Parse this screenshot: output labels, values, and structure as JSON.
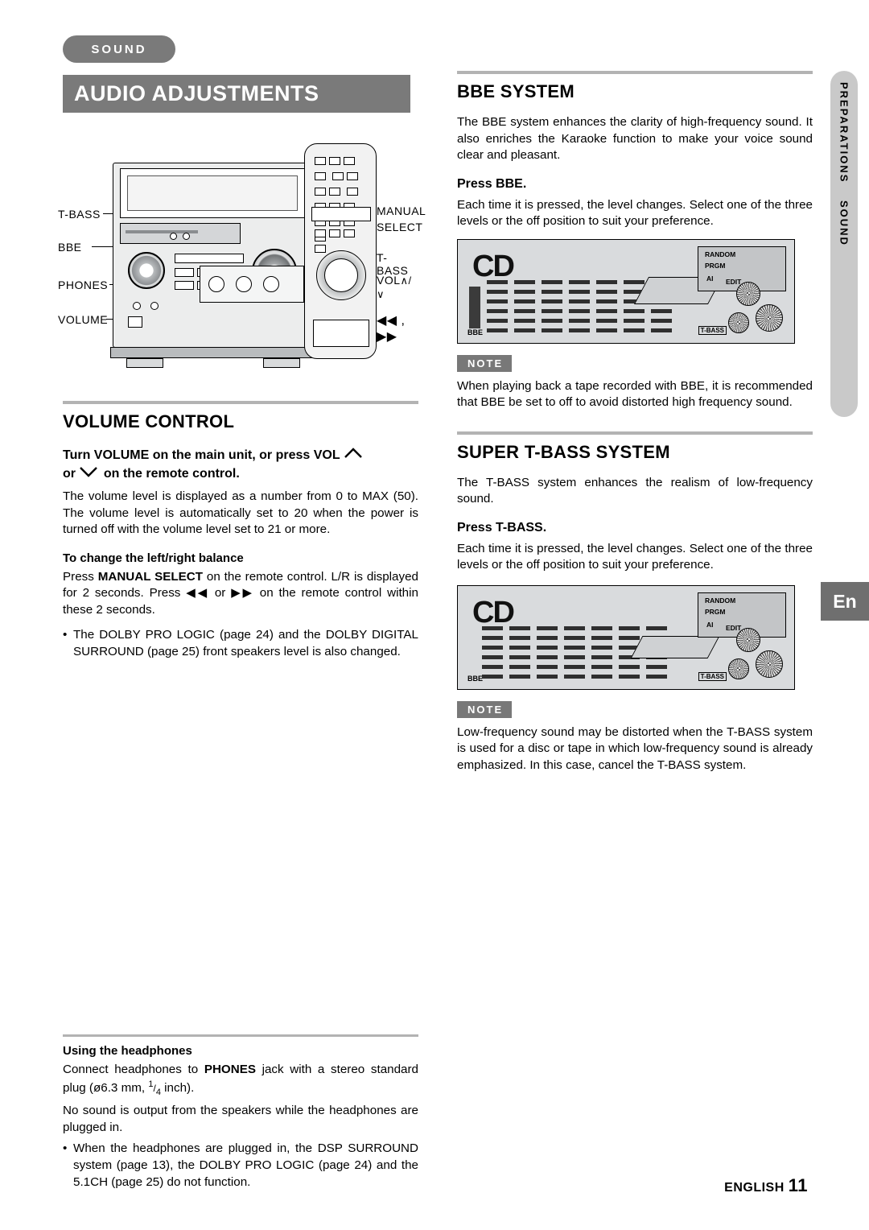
{
  "page": {
    "section_tag": "SOUND",
    "title": "AUDIO ADJUSTMENTS",
    "side_tab": {
      "text1": "PREPARATIONS",
      "text2": "SOUND"
    },
    "lang_box": "En",
    "footer_lang": "ENGLISH",
    "footer_page": "11"
  },
  "illustration": {
    "labels": {
      "t_bass": "T-BASS",
      "bbe": "BBE",
      "phones": "PHONES",
      "volume": "VOLUME",
      "manual": "MANUAL",
      "select": "SELECT",
      "remote_t_bass": "T-BASS",
      "vol": "VOL",
      "vol_arrows": "∧/∨",
      "skip": "◀◀ , ▶▶"
    }
  },
  "volume_control": {
    "heading": "VOLUME CONTROL",
    "instruction_line1": "Turn VOLUME on the main unit, or press VOL",
    "instruction_line2": "or",
    "instruction_line3": "on the remote control.",
    "body": "The volume level is displayed as a number from 0 to MAX (50). The volume level is automatically set to 20 when the power is turned off with the volume level set to 21 or more.",
    "balance_heading": "To change the left/right balance",
    "balance_body_1": "Press ",
    "balance_body_bold": "MANUAL SELECT",
    "balance_body_2": " on the remote control. L/R is displayed for 2 seconds. Press ",
    "balance_body_3": " or ",
    "balance_body_4": " on the remote control within these 2 seconds.",
    "bullets": [
      "The DOLBY PRO LOGIC (page 24) and the DOLBY DIGITAL SURROUND (page 25) front speakers level is also changed."
    ]
  },
  "headphones": {
    "heading": "Using the headphones",
    "line1_a": "Connect headphones to ",
    "line1_bold": "PHONES",
    "line1_b": " jack with a stereo standard plug (ø6.3 mm, ",
    "line1_frac": "1/4",
    "line1_c": " inch).",
    "line2": "No sound is output from the speakers while the headphones are plugged in.",
    "bullets": [
      "When the headphones are plugged in, the DSP SURROUND system (page 13), the DOLBY PRO LOGIC (page 24) and the 5.1CH (page 25) do not function."
    ]
  },
  "bbe": {
    "heading": "BBE SYSTEM",
    "body": "The BBE system enhances the clarity of high-frequency sound. It also enriches the Karaoke function to make your voice sound clear and pleasant.",
    "press_heading": "Press BBE.",
    "press_body": "Each time it is pressed, the level changes. Select one of the three levels or the off position to suit your preference.",
    "note_label": "NOTE",
    "note_body": "When playing back a tape recorded with BBE, it is recommended that BBE be set to off to avoid distorted high frequency sound."
  },
  "tbass": {
    "heading": "SUPER T-BASS SYSTEM",
    "body": "The T-BASS system enhances the realism of low-frequency sound.",
    "press_heading": "Press T-BASS.",
    "press_body": "Each time it is pressed, the level changes.  Select one of the three levels or the off position to suit your preference.",
    "note_label": "NOTE",
    "note_body": "Low-frequency sound may be distorted when the T-BASS system is used for a disc or tape in which low-frequency sound is already emphasized. In this case, cancel the T-BASS system."
  },
  "display_figure": {
    "cd_text": "CD",
    "bbe_text": "BBE",
    "tbass_text": "T-BASS",
    "panel": {
      "random": "RANDOM",
      "prgm": "PRGM",
      "ai": "AI",
      "edit": "EDIT"
    }
  }
}
